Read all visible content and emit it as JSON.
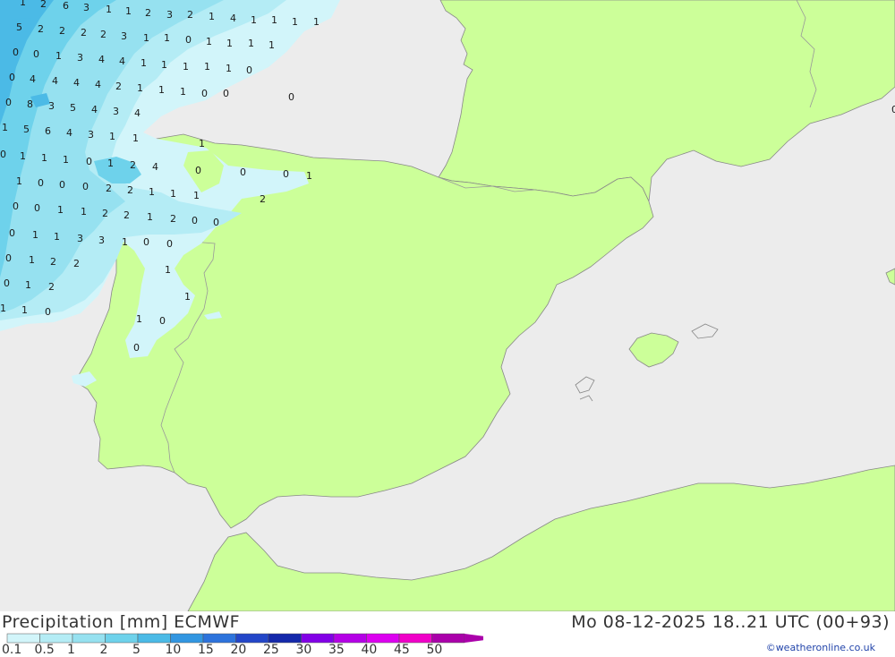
{
  "colors": {
    "sea": "#ececec",
    "land": "#ccff99",
    "border": "#999999",
    "coast": "#888888"
  },
  "footer": {
    "title_left": "Precipitation [mm] ECMWF",
    "title_right": "Mo 08-12-2025 18..21 UTC (00+93)",
    "credit": "©weatheronline.co.uk"
  },
  "legend": {
    "labels": [
      "0.1",
      "0.5",
      "1",
      "2",
      "5",
      "10",
      "15",
      "20",
      "25",
      "30",
      "35",
      "40",
      "45",
      "50"
    ],
    "colors": [
      "#d2f5fa",
      "#b4ecf5",
      "#96e1f0",
      "#6ed2eb",
      "#4bbae6",
      "#3296e1",
      "#2d73dc",
      "#2346c8",
      "#1428aa",
      "#8200e6",
      "#b400e6",
      "#dc00f0",
      "#f000c8",
      "#aa00aa"
    ]
  },
  "map": {
    "values": [
      "1",
      "2",
      "6",
      "3",
      "1",
      "1",
      "2",
      "3",
      "2",
      "1",
      "4",
      "1",
      "1",
      "1",
      "1",
      "5",
      "2",
      "2",
      "2",
      "2",
      "3",
      "1",
      "1",
      "0",
      "1",
      "1",
      "1",
      "1",
      "0",
      "0",
      "1",
      "3",
      "4",
      "4",
      "1",
      "1",
      "1",
      "1",
      "1",
      "0",
      "0",
      "4",
      "4",
      "4",
      "4",
      "2",
      "1",
      "1",
      "1",
      "0",
      "0",
      "0",
      "0",
      "8",
      "3",
      "5",
      "4",
      "3",
      "4",
      "1",
      "5",
      "6",
      "4",
      "3",
      "1",
      "1",
      "0",
      "1",
      "1",
      "1",
      "0",
      "1",
      "2",
      "4",
      "1",
      "1",
      "0",
      "0",
      "0",
      "2",
      "2",
      "1",
      "1",
      "1",
      "0",
      "0",
      "0",
      "1",
      "0",
      "0",
      "1",
      "1",
      "2",
      "2",
      "1",
      "2",
      "0",
      "0",
      "2",
      "0",
      "1",
      "1",
      "3",
      "3",
      "1",
      "0",
      "0",
      "0",
      "1",
      "2",
      "2",
      "1",
      "0",
      "1",
      "2",
      "1",
      "1",
      "1",
      "0",
      "0",
      "1",
      "0"
    ]
  }
}
